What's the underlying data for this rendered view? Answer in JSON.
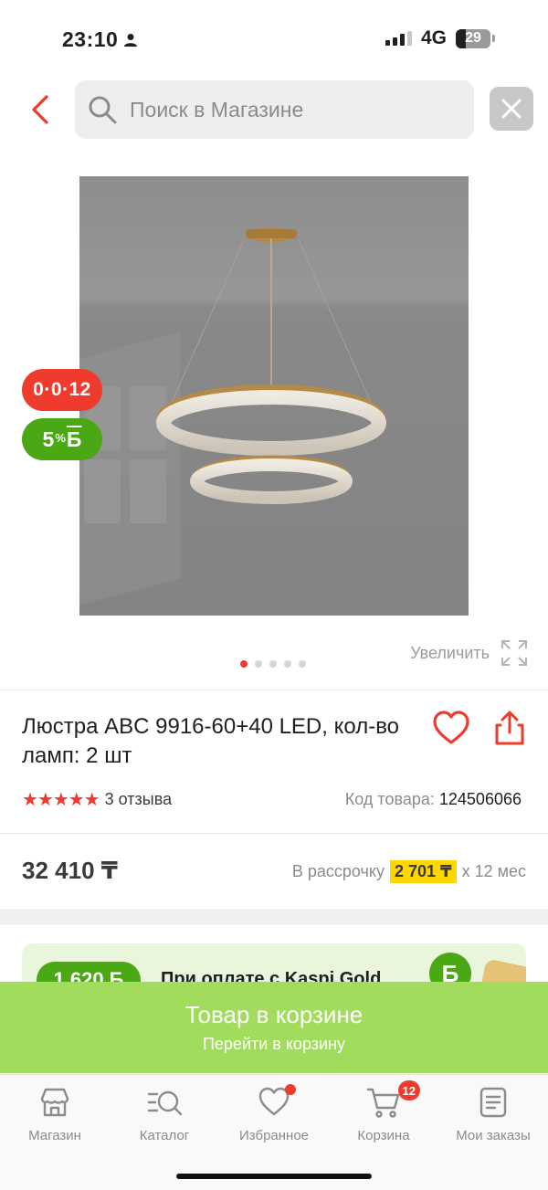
{
  "status_bar": {
    "time": "23:10",
    "network": "4G",
    "battery": "29"
  },
  "header": {
    "search_placeholder": "Поиск в Магазине",
    "icons": [
      "chevron-left-icon",
      "search-icon",
      "close-icon"
    ]
  },
  "product": {
    "badge_credit": "0·0·12",
    "badge_bonus_percent": "5",
    "badge_bonus_sup": "%",
    "badge_bonus_currency": "Б",
    "gallery": {
      "total": 5,
      "active_index": 0
    },
    "zoom_label": "Увеличить",
    "title": "Люстра ABC 9916-60+40 LED, кол-во ламп: 2 шт",
    "stars": 5,
    "reviews": "3 отзыва",
    "sku_label": "Код товара:",
    "sku_value": "124506066",
    "price": "32 410 ₸",
    "installment_label": "В рассрочку",
    "installment_amount": "2 701 ₸",
    "installment_term": "х 12 мес"
  },
  "gold_promo": {
    "amount": "1 620 Б",
    "text": "При оплате с Kaspi Gold",
    "coin_label": "Б"
  },
  "cart_banner": {
    "title": "Товар в корзине",
    "subtitle": "Перейти в корзину"
  },
  "tabbar": {
    "items": [
      {
        "label": "Магазин",
        "icon": "store-icon"
      },
      {
        "label": "Каталог",
        "icon": "catalog-search-icon"
      },
      {
        "label": "Избранное",
        "icon": "heart-icon"
      },
      {
        "label": "Корзина",
        "icon": "cart-icon",
        "badge": "12"
      },
      {
        "label": "Мои заказы",
        "icon": "orders-icon"
      }
    ]
  },
  "colors": {
    "accent_red": "#ef3b2d",
    "bonus_green": "#49a814",
    "cart_green": "#a1dc5c",
    "installment_yellow": "#ffd600"
  }
}
